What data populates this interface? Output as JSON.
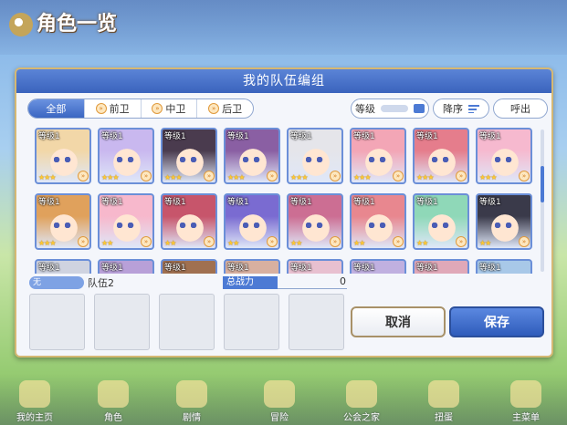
{
  "screen": {
    "title": "角色一览"
  },
  "bottom_nav": [
    {
      "label": "我的主页"
    },
    {
      "label": "角色"
    },
    {
      "label": "剧情"
    },
    {
      "label": "冒险"
    },
    {
      "label": "公会之家"
    },
    {
      "label": "扭蛋"
    },
    {
      "label": "主菜单"
    }
  ],
  "dialog": {
    "title": "我的队伍编组",
    "tabs": [
      {
        "label": "全部",
        "active": true
      },
      {
        "label": "前卫",
        "active": false
      },
      {
        "label": "中卫",
        "active": false
      },
      {
        "label": "后卫",
        "active": false
      }
    ],
    "sort_label": "等级",
    "order_label": "降序",
    "call_label": "呼出",
    "characters": [
      {
        "level": "等级1",
        "stars": "★★★"
      },
      {
        "level": "等级1",
        "stars": "★★★"
      },
      {
        "level": "等级1",
        "stars": "★★★"
      },
      {
        "level": "等级1",
        "stars": "★★★"
      },
      {
        "level": "等级1",
        "stars": "★★★"
      },
      {
        "level": "等级1",
        "stars": "★★★"
      },
      {
        "level": "等级1",
        "stars": "★★★"
      },
      {
        "level": "等级1",
        "stars": "★★★"
      },
      {
        "level": "等级1",
        "stars": "★★★"
      },
      {
        "level": "等级1",
        "stars": "★★"
      },
      {
        "level": "等级1",
        "stars": "★★"
      },
      {
        "level": "等级1",
        "stars": "★★"
      },
      {
        "level": "等级1",
        "stars": "★★"
      },
      {
        "level": "等级1",
        "stars": "★★"
      },
      {
        "level": "等级1",
        "stars": "★★"
      },
      {
        "level": "等级1",
        "stars": "★★"
      },
      {
        "level": "等级1",
        "stars": ""
      },
      {
        "level": "等级1",
        "stars": ""
      },
      {
        "level": "等级1",
        "stars": ""
      },
      {
        "level": "等级1",
        "stars": ""
      },
      {
        "level": "等级1",
        "stars": ""
      },
      {
        "level": "等级1",
        "stars": ""
      },
      {
        "level": "等级1",
        "stars": ""
      },
      {
        "level": "等级1",
        "stars": ""
      }
    ],
    "team": {
      "tag": "无",
      "name": "队伍2",
      "power_label": "总战力",
      "power_value": "0"
    },
    "buttons": {
      "cancel": "取消",
      "save": "保存"
    }
  },
  "colors": {
    "header": "#3a63bd",
    "accent": "#4c7ad4",
    "card_border": "#6b8fd8",
    "gold_border": "#d5b873"
  }
}
